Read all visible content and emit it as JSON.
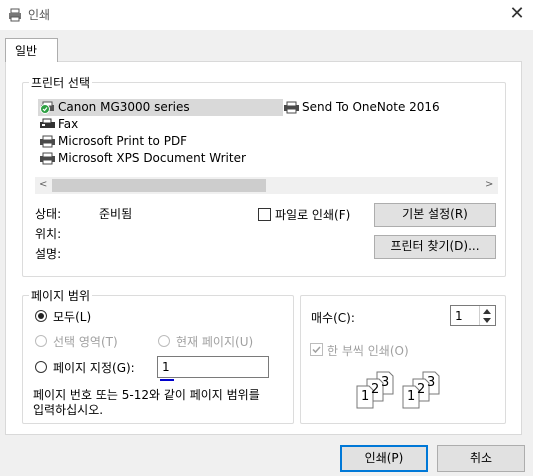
{
  "window": {
    "title": "인쇄",
    "close_glyph": "✕"
  },
  "tab": {
    "label": "일반"
  },
  "printer_group": {
    "title": "프린터 선택",
    "printers_col1": [
      {
        "name": "Canon MG3000 series",
        "icon": "printer-default-icon",
        "selected": true
      },
      {
        "name": "Fax",
        "icon": "fax-icon"
      },
      {
        "name": "Microsoft Print to PDF",
        "icon": "printer-icon"
      },
      {
        "name": "Microsoft XPS Document Writer",
        "icon": "printer-icon"
      }
    ],
    "printers_col2": [
      {
        "name": "Send To OneNote 2016",
        "icon": "printer-icon"
      }
    ],
    "scroll_left": "<",
    "scroll_right": ">",
    "status_label": "상태:",
    "status_value": "준비됨",
    "location_label": "위치:",
    "comment_label": "설명:",
    "print_to_file": {
      "label": "파일로 인쇄(F)",
      "checked": false
    },
    "preferences_button": "기본 설정(R)",
    "find_printer_button": "프린터 찾기(D)..."
  },
  "page_range": {
    "title": "페이지 범위",
    "all": "모두(L)",
    "selection": "선택 영역(T)",
    "current_page": "현재 페이지(U)",
    "pages": "페이지 지정(G):",
    "pages_value": "1",
    "hint_line1": "페이지 번호 또는 5-12와 같이 페이지 범위를",
    "hint_line2": "입력하십시오."
  },
  "copies": {
    "label": "매수(C):",
    "value": "1",
    "collate": {
      "label": "한 부씩 인쇄(O)",
      "checked": true,
      "enabled": false
    },
    "collate_pages": [
      "1",
      "2",
      "3"
    ]
  },
  "footer": {
    "print_button": "인쇄(P)",
    "cancel_button": "취소"
  }
}
